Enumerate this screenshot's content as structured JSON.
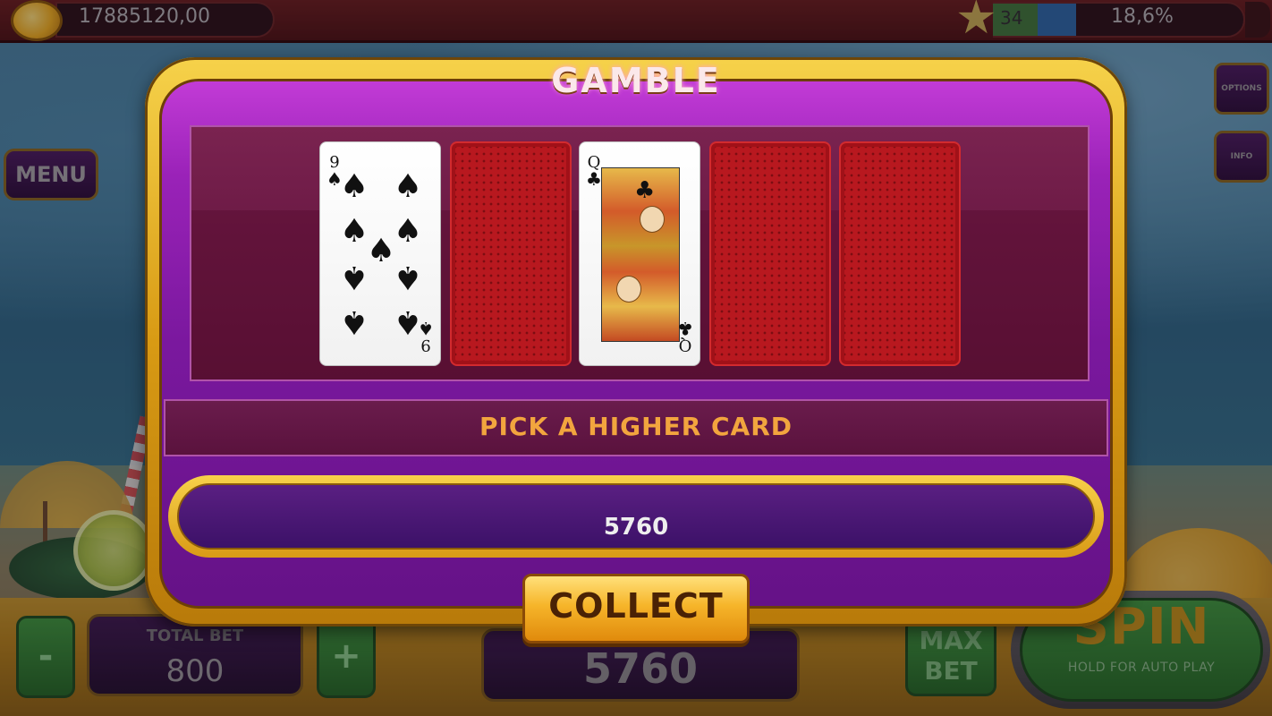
{
  "header": {
    "balance": "17885120,00",
    "level": "34",
    "level_progress_pct": 18.6,
    "level_progress_text": "18,6%"
  },
  "side_buttons": {
    "menu": "MENU",
    "options": "OPTIONS",
    "info": "INFO"
  },
  "bottom": {
    "minus": "-",
    "plus": "+",
    "total_bet_label": "TOTAL BET",
    "total_bet_value": "800",
    "win_value": "5760",
    "max_bet_line1": "MAX",
    "max_bet_line2": "BET",
    "spin_label": "SPIN",
    "spin_sub": "HOLD FOR AUTO PLAY"
  },
  "gamble": {
    "title": "GAMBLE",
    "message": "PICK A HIGHER CARD",
    "amount": "5760",
    "collect_label": "COLLECT",
    "cards": [
      {
        "state": "face",
        "rank": "9",
        "suit": "spades",
        "suit_symbol": "♠"
      },
      {
        "state": "back"
      },
      {
        "state": "face",
        "rank": "Q",
        "suit": "clubs",
        "suit_symbol": "♣"
      },
      {
        "state": "back"
      },
      {
        "state": "back"
      }
    ]
  },
  "colors": {
    "modal_purple": "#9a22b8",
    "gold_frame": "#d89a14",
    "message_text": "#f2a53e",
    "card_back_red": "#b8181f",
    "spin_green": "#2f8a2e"
  }
}
